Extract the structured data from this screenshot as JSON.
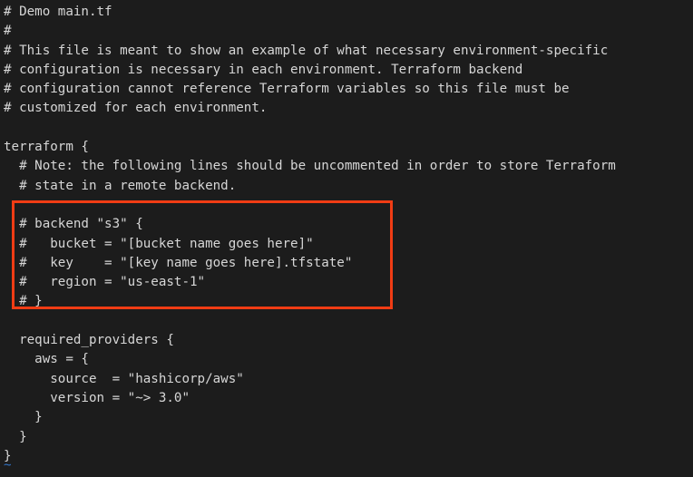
{
  "editor": {
    "kind": "vim-terminal-editor",
    "background_color": "#1c1c1c",
    "text_color": "#d6d6d6",
    "empty_line_marker": "~",
    "empty_line_marker_color": "#2f6fc0"
  },
  "annotation": {
    "type": "rectangle-highlight",
    "color": "#f03c14",
    "label": "backend-s3-block-highlight"
  },
  "code": {
    "filename": "main.tf",
    "language": "terraform",
    "lines": [
      "# Demo main.tf",
      "#",
      "# This file is meant to show an example of what necessary environment-specific",
      "# configuration is necessary in each environment. Terraform backend",
      "# configuration cannot reference Terraform variables so this file must be",
      "# customized for each environment.",
      "",
      "terraform {",
      "  # Note: the following lines should be uncommented in order to store Terraform",
      "  # state in a remote backend.",
      "",
      "  # backend \"s3\" {",
      "  #   bucket = \"[bucket name goes here]\"",
      "  #   key    = \"[key name goes here].tfstate\"",
      "  #   region = \"us-east-1\"",
      "  # }",
      "",
      "  required_providers {",
      "    aws = {",
      "      source  = \"hashicorp/aws\"",
      "      version = \"~> 3.0\"",
      "    }",
      "  }",
      "}"
    ]
  }
}
